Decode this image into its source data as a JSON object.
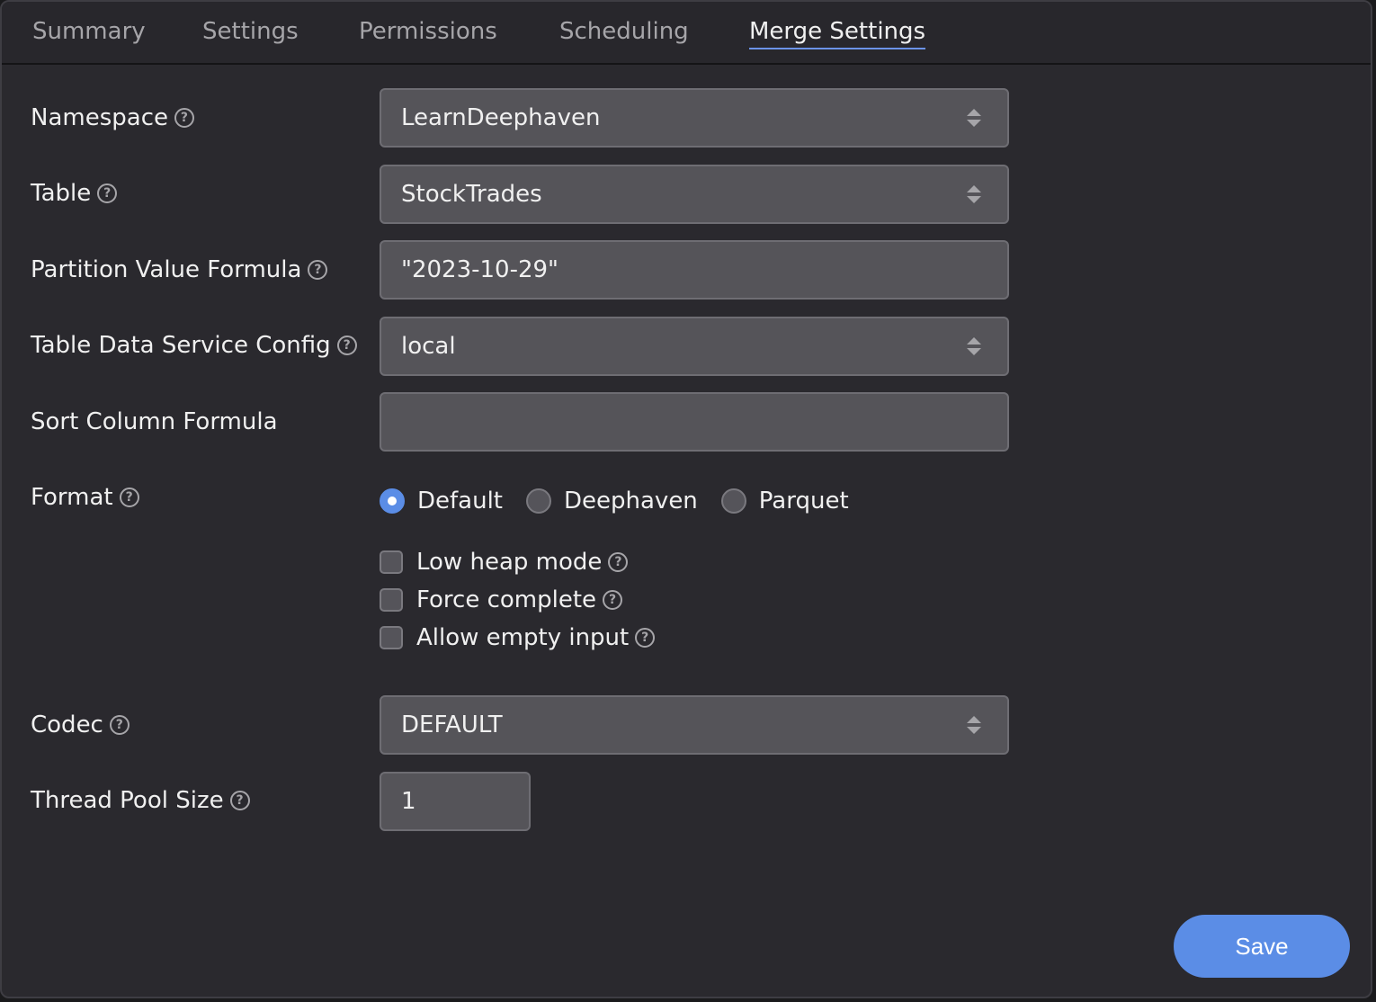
{
  "tabs": [
    {
      "label": "Summary",
      "active": false
    },
    {
      "label": "Settings",
      "active": false
    },
    {
      "label": "Permissions",
      "active": false
    },
    {
      "label": "Scheduling",
      "active": false
    },
    {
      "label": "Merge Settings",
      "active": true
    }
  ],
  "help_glyph": "?",
  "form": {
    "namespace": {
      "label": "Namespace",
      "value": "LearnDeephaven"
    },
    "table": {
      "label": "Table",
      "value": "StockTrades"
    },
    "partition_value_formula": {
      "label": "Partition Value Formula",
      "value": "\"2023-10-29\""
    },
    "table_data_service_config": {
      "label": "Table Data Service Config",
      "value": "local"
    },
    "sort_column_formula": {
      "label": "Sort Column Formula",
      "value": ""
    },
    "format": {
      "label": "Format",
      "options": [
        {
          "label": "Default",
          "selected": true
        },
        {
          "label": "Deephaven",
          "selected": false
        },
        {
          "label": "Parquet",
          "selected": false
        }
      ]
    },
    "checkboxes": [
      {
        "label": "Low heap mode",
        "checked": false
      },
      {
        "label": "Force complete",
        "checked": false
      },
      {
        "label": "Allow empty input",
        "checked": false
      }
    ],
    "codec": {
      "label": "Codec",
      "value": "DEFAULT"
    },
    "thread_pool_size": {
      "label": "Thread Pool Size",
      "value": "1"
    }
  },
  "save_label": "Save",
  "colors": {
    "accent": "#5b8de6",
    "background": "#2a292e",
    "field": "#555459"
  }
}
